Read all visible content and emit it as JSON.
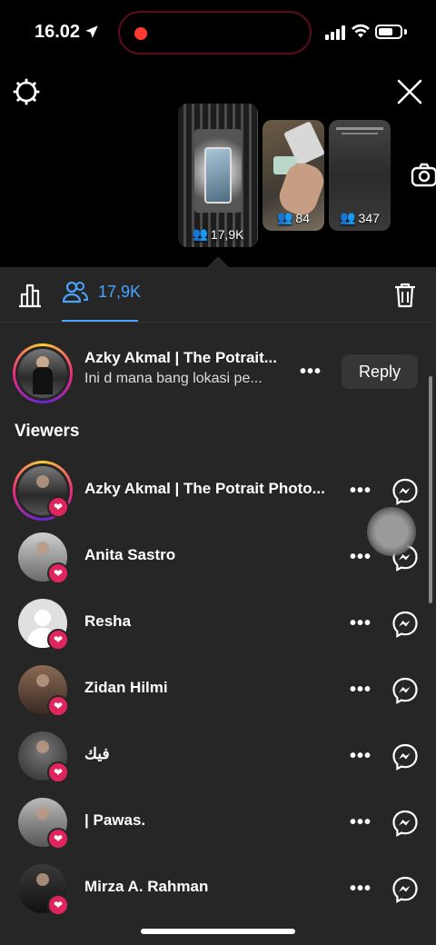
{
  "status_bar": {
    "time": "16.02",
    "battery_level": 0.7
  },
  "stories": [
    {
      "count": "17,9K"
    },
    {
      "count": "84"
    },
    {
      "count": "347"
    }
  ],
  "tabs": {
    "viewers_count": "17,9K"
  },
  "reply": {
    "name": "Azky Akmal | The Potrait...",
    "message": "Ini d mana bang lokasi pe...",
    "more": "•••",
    "button": "Reply"
  },
  "viewers_title": "Viewers",
  "viewers": [
    {
      "name": "Azky Akmal | The Potrait Photo...",
      "liked": true
    },
    {
      "name": "Anita Sastro",
      "liked": true
    },
    {
      "name": "Resha",
      "liked": true
    },
    {
      "name": "Zidan Hilmi",
      "liked": true
    },
    {
      "name": "فيك",
      "liked": true
    },
    {
      "name": "| Pawas.",
      "liked": true
    },
    {
      "name": "Mirza A. Rahman",
      "liked": true
    }
  ],
  "more_label": "•••",
  "colors": {
    "accent": "#4aa3ff",
    "heart": "#e0245e",
    "sheet": "#262626"
  }
}
